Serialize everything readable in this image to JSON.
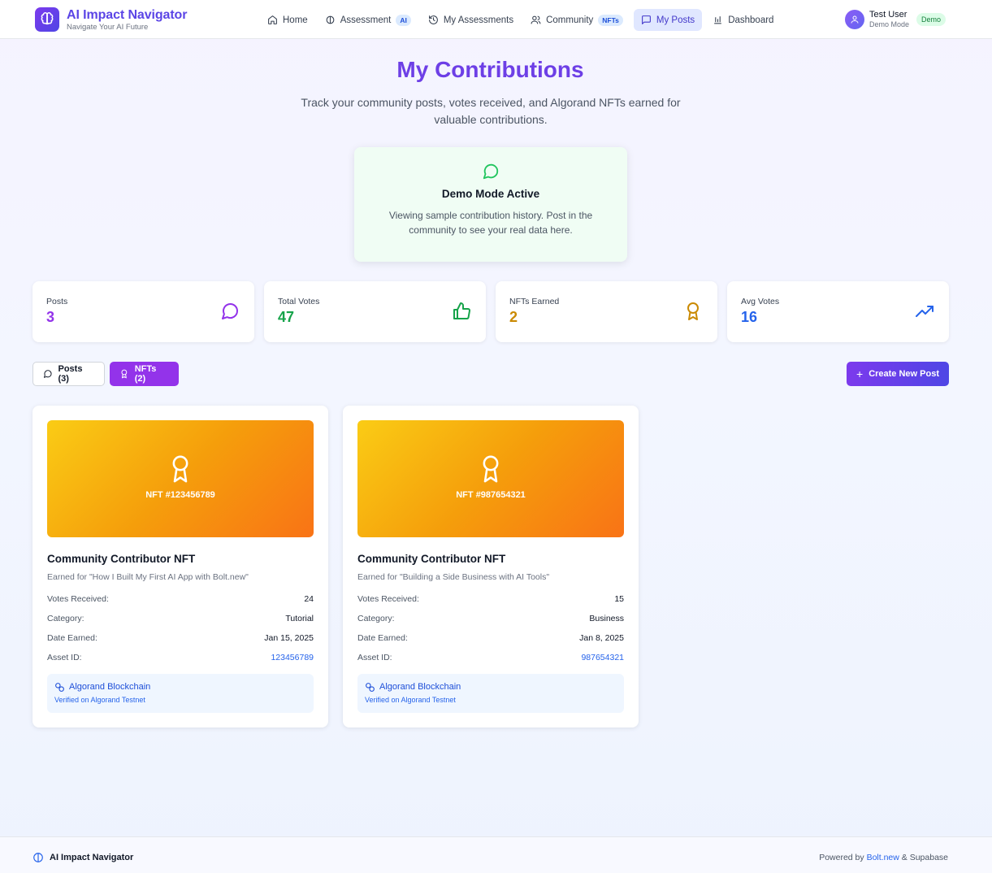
{
  "header": {
    "brand_title": "AI Impact Navigator",
    "brand_subtitle": "Navigate Your AI Future",
    "nav": [
      {
        "label": "Home",
        "icon": "home-icon"
      },
      {
        "label": "Assessment",
        "icon": "brain-icon",
        "badge": "AI"
      },
      {
        "label": "My Assessments",
        "icon": "history-icon"
      },
      {
        "label": "Community",
        "icon": "users-icon",
        "badge": "NFTs"
      },
      {
        "label": "My Posts",
        "icon": "message-icon",
        "active": true
      },
      {
        "label": "Dashboard",
        "icon": "bar-chart-icon"
      }
    ],
    "user_name": "Test User",
    "user_mode": "Demo Mode",
    "demo_badge": "Demo"
  },
  "page": {
    "title": "My Contributions",
    "subtitle": "Track your community posts, votes received, and Algorand NFTs earned for valuable contributions."
  },
  "demo_notice": {
    "title": "Demo Mode Active",
    "text": "Viewing sample contribution history. Post in the community to see your real data here."
  },
  "stats": [
    {
      "label": "Posts",
      "value": "3",
      "color": "#9333ea",
      "icon": "message-icon"
    },
    {
      "label": "Total Votes",
      "value": "47",
      "color": "#16a34a",
      "icon": "thumbs-up-icon"
    },
    {
      "label": "NFTs Earned",
      "value": "2",
      "color": "#ca8a04",
      "icon": "award-icon"
    },
    {
      "label": "Avg Votes",
      "value": "16",
      "color": "#2563eb",
      "icon": "trending-up-icon"
    }
  ],
  "tabs": {
    "posts_label": "Posts (3)",
    "nfts_label": "NFTs (2)",
    "create_label": "Create New Post"
  },
  "row_labels": {
    "votes": "Votes Received:",
    "category": "Category:",
    "date": "Date Earned:",
    "asset": "Asset ID:"
  },
  "nfts": [
    {
      "id_label": "NFT #123456789",
      "title": "Community Contributor NFT",
      "earned_for": "Earned for \"How I Built My First AI App with Bolt.new\"",
      "votes": "24",
      "category": "Tutorial",
      "date": "Jan 15, 2025",
      "asset_id": "123456789",
      "chain_title": "Algorand Blockchain",
      "chain_sub": "Verified on Algorand Testnet"
    },
    {
      "id_label": "NFT #987654321",
      "title": "Community Contributor NFT",
      "earned_for": "Earned for \"Building a Side Business with AI Tools\"",
      "votes": "15",
      "category": "Business",
      "date": "Jan 8, 2025",
      "asset_id": "987654321",
      "chain_title": "Algorand Blockchain",
      "chain_sub": "Verified on Algorand Testnet"
    }
  ],
  "footer": {
    "brand": "AI Impact Navigator",
    "powered_prefix": "Powered by",
    "powered_bolt": "Bolt.new",
    "powered_suffix": "& Supabase"
  }
}
